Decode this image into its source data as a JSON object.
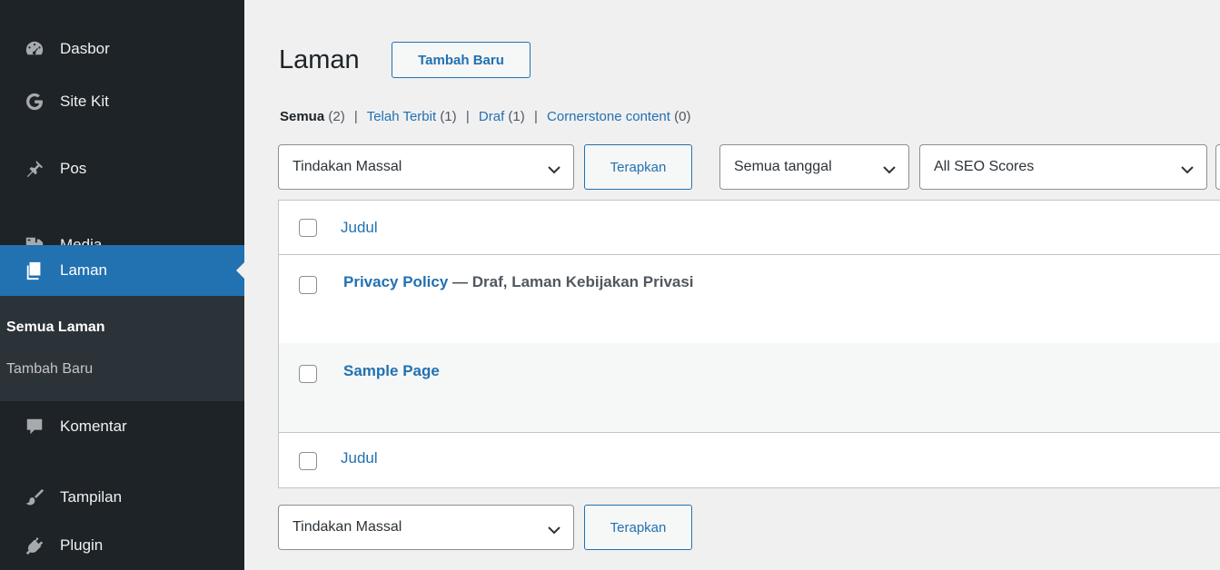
{
  "sidebar": {
    "items": [
      {
        "label": "Dasbor",
        "icon": "dashboard-icon"
      },
      {
        "label": "Site Kit",
        "icon": "google-g-icon"
      },
      {
        "label": "Pos",
        "icon": "pushpin-icon"
      },
      {
        "label": "Media",
        "icon": "media-icon"
      },
      {
        "label": "Laman",
        "icon": "pages-icon",
        "active": true
      },
      {
        "label": "Komentar",
        "icon": "comment-icon"
      },
      {
        "label": "Tampilan",
        "icon": "paintbrush-icon"
      },
      {
        "label": "Plugin",
        "icon": "plugin-icon"
      }
    ],
    "submenu": [
      {
        "label": "Semua Laman",
        "current": true
      },
      {
        "label": "Tambah Baru"
      }
    ]
  },
  "header": {
    "title": "Laman",
    "add_new_label": "Tambah Baru"
  },
  "filters": {
    "views": [
      {
        "label": "Semua",
        "count": "(2)",
        "current": true
      },
      {
        "label": "Telah Terbit",
        "count": "(1)"
      },
      {
        "label": "Draf",
        "count": "(1)"
      },
      {
        "label": "Cornerstone content",
        "count": "(0)"
      }
    ],
    "separator": "|",
    "bulk_action_top": "Tindakan Massal",
    "apply_top": "Terapkan",
    "date_filter": "Semua tanggal",
    "seo_filter": "All SEO Scores",
    "bulk_action_bottom": "Tindakan Massal",
    "apply_bottom": "Terapkan"
  },
  "table": {
    "header_title": "Judul",
    "footer_title": "Judul",
    "rows": [
      {
        "title": "Privacy Policy",
        "state": " — Draf, Laman Kebijakan Privasi"
      },
      {
        "title": "Sample Page",
        "state": ""
      }
    ]
  },
  "colors": {
    "sidebar_bg": "#1d2327",
    "accent": "#2271b1",
    "content_bg": "#f0f0f1"
  }
}
